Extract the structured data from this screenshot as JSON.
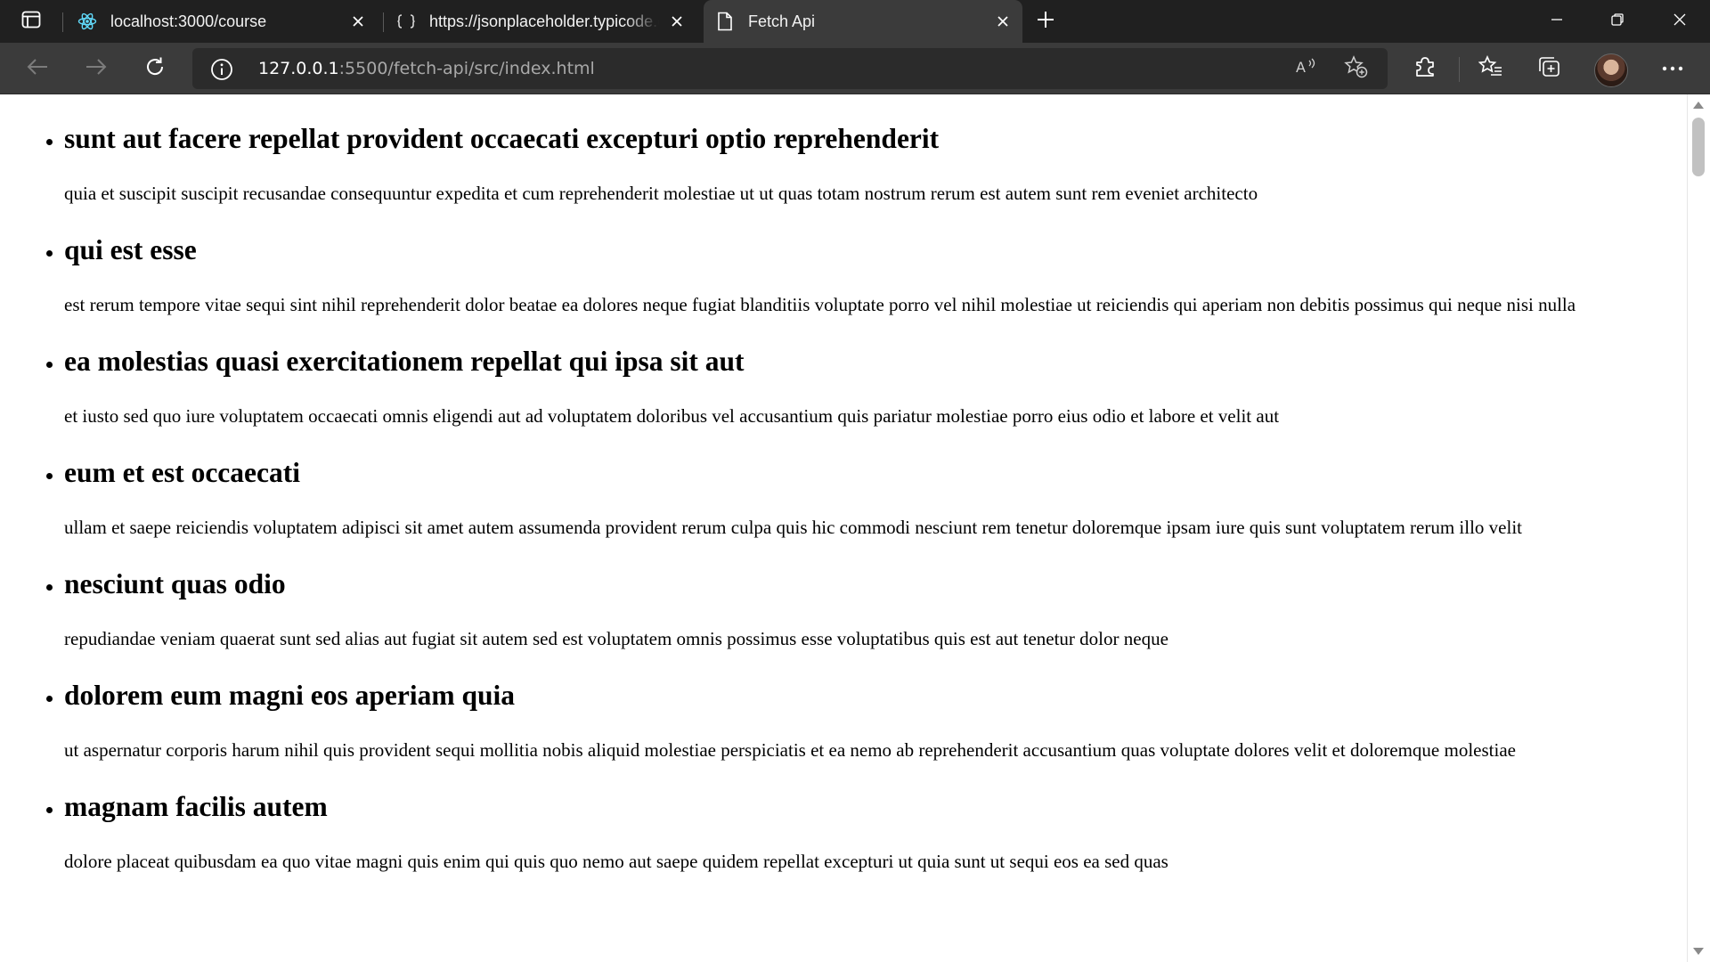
{
  "browser": {
    "tabs": [
      {
        "title": "localhost:3000/course",
        "favicon": "react-icon"
      },
      {
        "title": "https://jsonplaceholder.typicode.com/posts",
        "favicon": "json-icon"
      },
      {
        "title": "Fetch Api",
        "favicon": "page-icon"
      }
    ],
    "address": {
      "host": "127.0.0.1",
      "rest": ":5500/fetch-api/src/index.html"
    }
  },
  "posts": [
    {
      "title": "sunt aut facere repellat provident occaecati excepturi optio reprehenderit",
      "body": "quia et suscipit suscipit recusandae consequuntur expedita et cum reprehenderit molestiae ut ut quas totam nostrum rerum est autem sunt rem eveniet architecto"
    },
    {
      "title": "qui est esse",
      "body": "est rerum tempore vitae sequi sint nihil reprehenderit dolor beatae ea dolores neque fugiat blanditiis voluptate porro vel nihil molestiae ut reiciendis qui aperiam non debitis possimus qui neque nisi nulla"
    },
    {
      "title": "ea molestias quasi exercitationem repellat qui ipsa sit aut",
      "body": "et iusto sed quo iure voluptatem occaecati omnis eligendi aut ad voluptatem doloribus vel accusantium quis pariatur molestiae porro eius odio et labore et velit aut"
    },
    {
      "title": "eum et est occaecati",
      "body": "ullam et saepe reiciendis voluptatem adipisci sit amet autem assumenda provident rerum culpa quis hic commodi nesciunt rem tenetur doloremque ipsam iure quis sunt voluptatem rerum illo velit"
    },
    {
      "title": "nesciunt quas odio",
      "body": "repudiandae veniam quaerat sunt sed alias aut fugiat sit autem sed est voluptatem omnis possimus esse voluptatibus quis est aut tenetur dolor neque"
    },
    {
      "title": "dolorem eum magni eos aperiam quia",
      "body": "ut aspernatur corporis harum nihil quis provident sequi mollitia nobis aliquid molestiae perspiciatis et ea nemo ab reprehenderit accusantium quas voluptate dolores velit et doloremque molestiae"
    },
    {
      "title": "magnam facilis autem",
      "body": "dolore placeat quibusdam ea quo vitae magni quis enim qui quis quo nemo aut saepe quidem repellat excepturi ut quia sunt ut sequi eos ea sed quas"
    }
  ]
}
